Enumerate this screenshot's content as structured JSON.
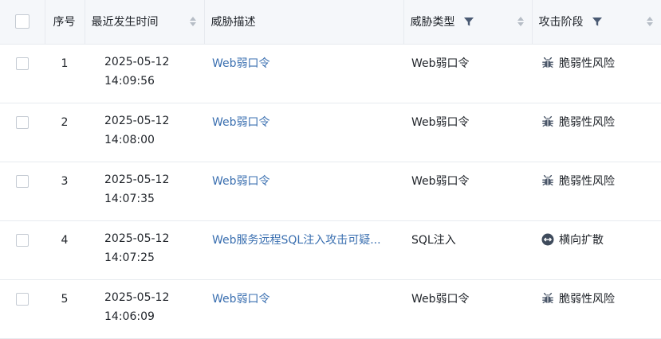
{
  "table": {
    "columns": {
      "seq": "序号",
      "time": "最近发生时间",
      "desc": "威胁描述",
      "type": "威胁类型",
      "stage": "攻击阶段"
    },
    "rows": [
      {
        "seq": "1",
        "date": "2025-05-12",
        "time": "14:09:56",
        "desc": "Web弱口令",
        "type": "Web弱口令",
        "stage": "脆弱性风险",
        "stage_icon": "bug-icon"
      },
      {
        "seq": "2",
        "date": "2025-05-12",
        "time": "14:08:00",
        "desc": "Web弱口令",
        "type": "Web弱口令",
        "stage": "脆弱性风险",
        "stage_icon": "bug-icon"
      },
      {
        "seq": "3",
        "date": "2025-05-12",
        "time": "14:07:35",
        "desc": "Web弱口令",
        "type": "Web弱口令",
        "stage": "脆弱性风险",
        "stage_icon": "bug-icon"
      },
      {
        "seq": "4",
        "date": "2025-05-12",
        "time": "14:07:25",
        "desc": "Web服务远程SQL注入攻击可疑...",
        "type": "SQL注入",
        "stage": "横向扩散",
        "stage_icon": "lateral-movement-icon"
      },
      {
        "seq": "5",
        "date": "2025-05-12",
        "time": "14:06:09",
        "desc": "Web弱口令",
        "type": "Web弱口令",
        "stage": "脆弱性风险",
        "stage_icon": "bug-icon"
      }
    ]
  },
  "colors": {
    "link": "#3a6fb0",
    "header_bg": "#f5f7fa",
    "icon": "#4a5668",
    "filter_icon": "#4a5a73"
  }
}
